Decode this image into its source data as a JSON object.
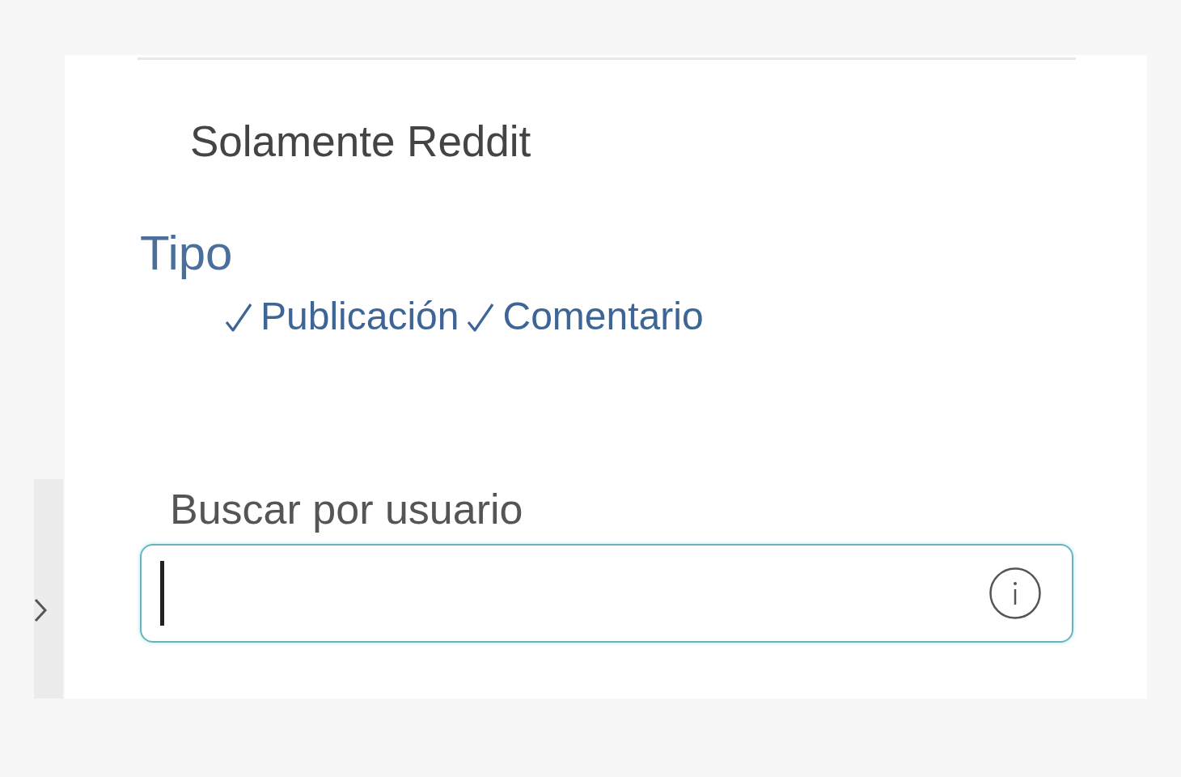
{
  "side_toggle": {
    "expanded": false
  },
  "filter_option": {
    "label": "Solamente Reddit"
  },
  "type_section": {
    "title": "Tipo",
    "options": [
      {
        "label": "Publicación",
        "checked": true
      },
      {
        "label": "Comentario",
        "checked": true
      }
    ]
  },
  "user_search": {
    "label": "Buscar por usuario",
    "focused": true
  }
}
